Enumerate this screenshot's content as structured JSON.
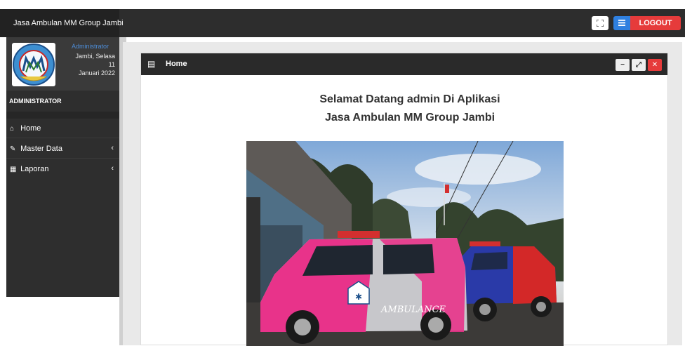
{
  "app": {
    "title": "Jasa Ambulan MM Group Jambi"
  },
  "topbar": {
    "fullscreen_icon": "expand-icon",
    "menu_icon": "bars-icon",
    "logout_label": "LOGOUT",
    "settings_icon": "gear-icon"
  },
  "user_panel": {
    "role": "Administrator",
    "date_line1": "Jambi, Selasa 11",
    "date_line2": "Januari 2022"
  },
  "sidebar": {
    "header": "ADMINISTRATOR",
    "items": [
      {
        "label": "Home",
        "icon": "home-icon",
        "has_submenu": false
      },
      {
        "label": "Master Data",
        "icon": "edit-icon",
        "has_submenu": true
      },
      {
        "label": "Laporan",
        "icon": "calendar-icon",
        "has_submenu": true
      }
    ]
  },
  "panel": {
    "title": "Home",
    "welcome_line1": "Selamat Datang admin Di Aplikasi",
    "welcome_line2": "Jasa Ambulan MM Group Jambi"
  },
  "photo_text": {
    "ambulance_label": "AMBULANCE"
  },
  "colors": {
    "topbar": "#2d2d2d",
    "sidebar": "#2e2e2e",
    "accent_blue": "#2f80e0",
    "logout_red": "#e63b3b",
    "role_blue": "#4d8cd6"
  }
}
